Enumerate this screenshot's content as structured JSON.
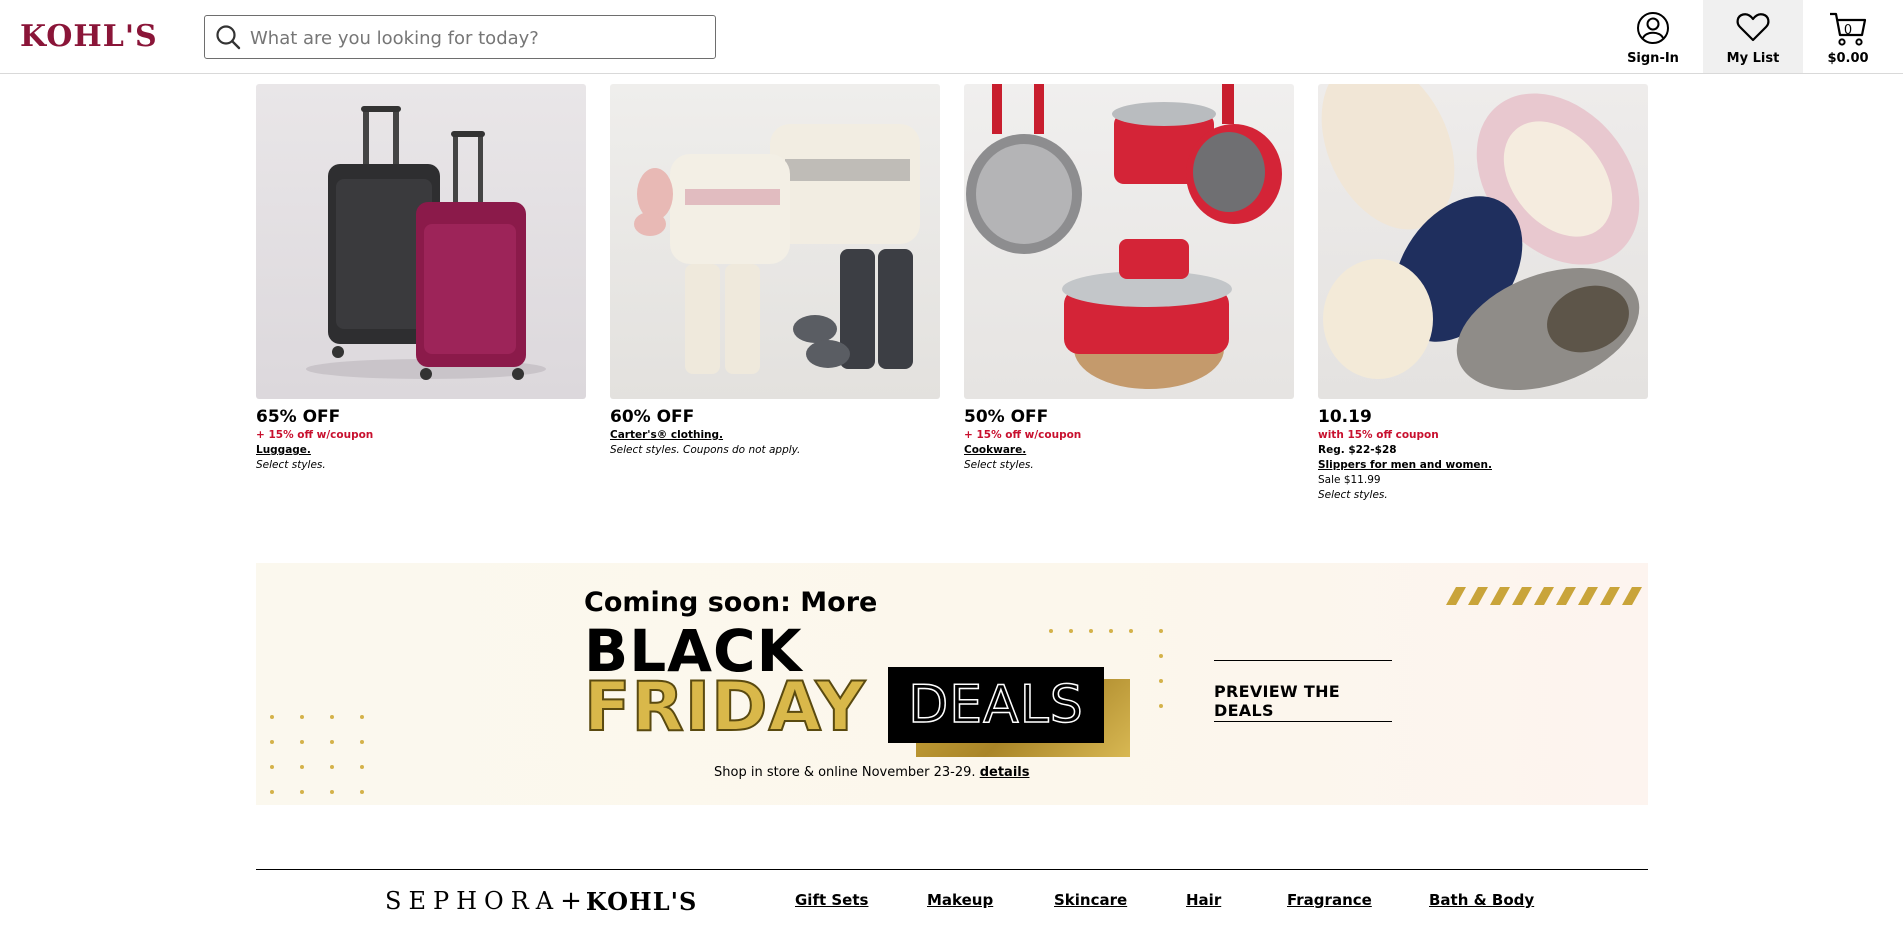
{
  "header": {
    "logo": "KOHL'S",
    "search_placeholder": "What are you looking for today?",
    "signin_label": "Sign-In",
    "mylist_label": "My List",
    "cart_count": "0",
    "cart_total": "$0.00"
  },
  "tiles": [
    {
      "headline": "65% OFF",
      "coupon": "+ 15% off w/coupon",
      "category": "Luggage.",
      "note": "Select styles."
    },
    {
      "headline": "60% OFF",
      "category": "Carter's® clothing.",
      "note": "Select styles. Coupons do not apply."
    },
    {
      "headline": "50% OFF",
      "coupon": "+ 15% off w/coupon",
      "category": "Cookware.",
      "note": "Select styles."
    },
    {
      "headline": "10.19",
      "coupon": "with 15% off coupon",
      "regular": "Reg. $22-$28",
      "category": "Slippers for men and women.",
      "sale": "Sale $11.99",
      "note": "Select styles."
    }
  ],
  "banner": {
    "coming": "Coming soon: More",
    "black": "BLACK",
    "friday": "FRIDAY",
    "deals": "DEALS",
    "shop_text": "Shop in store & online November 23-29.",
    "details_link": "details",
    "cta": "PREVIEW THE DEALS"
  },
  "sephora": {
    "logo_left": "SEPHORA",
    "logo_plus": "+",
    "logo_right": "KOHL'S",
    "links": [
      "Gift Sets",
      "Makeup",
      "Skincare",
      "Hair",
      "Fragrance",
      "Bath & Body"
    ]
  },
  "colors": {
    "brand": "#8a1538",
    "promo_red": "#c8102e",
    "gold": "#d4b24a"
  }
}
